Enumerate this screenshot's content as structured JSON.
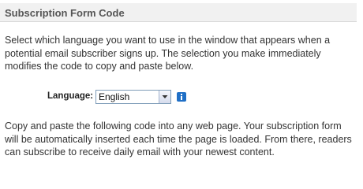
{
  "header": {
    "title": "Subscription Form Code"
  },
  "intro_text": "Select which language you want to use in the window that appears when a potential email subscriber signs up. The selection you make immediately modifies the code to copy and paste below.",
  "language": {
    "label": "Language:",
    "selected": "English",
    "arrow_icon": "chevron-down-icon",
    "info_icon": "info-icon",
    "info_color": "#1f6fc6"
  },
  "instructions_text": "Copy and paste the following code into any web page. Your subscription form will be automatically inserted each time the page is loaded. From there, readers can subscribe to receive daily email with your newest content."
}
